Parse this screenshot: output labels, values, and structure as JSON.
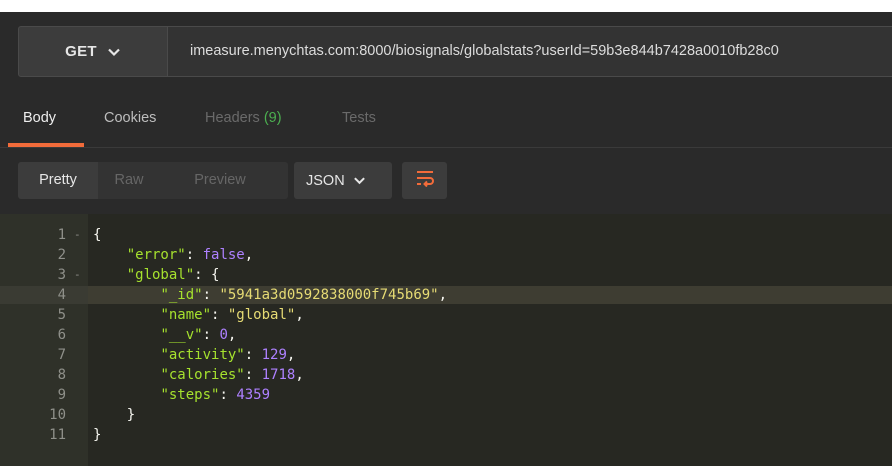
{
  "request": {
    "method": "GET",
    "url": "imeasure.menychtas.com:8000/biosignals/globalstats?userId=59b3e844b7428a0010fb28c0"
  },
  "response_tabs": [
    {
      "label": "Body"
    },
    {
      "label": "Cookies"
    },
    {
      "label": "Headers",
      "count": "(9)"
    },
    {
      "label": "Tests"
    }
  ],
  "view_modes": {
    "pretty": "Pretty",
    "raw": "Raw",
    "preview": "Preview",
    "format": "JSON"
  },
  "colors": {
    "accent": "#f26b3a",
    "count_green": "#4caf50",
    "json_key": "#a6e22e",
    "json_string": "#e6db74",
    "json_number": "#ae81ff"
  },
  "code_lines": [
    {
      "ln": "1",
      "fold": "-",
      "tokens": [
        [
          "p",
          "{"
        ]
      ]
    },
    {
      "ln": "2",
      "tokens": [
        [
          "p",
          "    "
        ],
        [
          "k",
          "\"error\""
        ],
        [
          "p",
          ": "
        ],
        [
          "n",
          "false"
        ],
        [
          "p",
          ","
        ]
      ]
    },
    {
      "ln": "3",
      "fold": "-",
      "tokens": [
        [
          "p",
          "    "
        ],
        [
          "k",
          "\"global\""
        ],
        [
          "p",
          ": {"
        ]
      ]
    },
    {
      "ln": "4",
      "hl": true,
      "tokens": [
        [
          "p",
          "        "
        ],
        [
          "k",
          "\"_id\""
        ],
        [
          "p",
          ": "
        ],
        [
          "s",
          "\"5941a3d0592838000f745b69\""
        ],
        [
          "p",
          ","
        ]
      ]
    },
    {
      "ln": "5",
      "tokens": [
        [
          "p",
          "        "
        ],
        [
          "k",
          "\"name\""
        ],
        [
          "p",
          ": "
        ],
        [
          "s",
          "\"global\""
        ],
        [
          "p",
          ","
        ]
      ]
    },
    {
      "ln": "6",
      "tokens": [
        [
          "p",
          "        "
        ],
        [
          "k",
          "\"__v\""
        ],
        [
          "p",
          ": "
        ],
        [
          "n",
          "0"
        ],
        [
          "p",
          ","
        ]
      ]
    },
    {
      "ln": "7",
      "tokens": [
        [
          "p",
          "        "
        ],
        [
          "k",
          "\"activity\""
        ],
        [
          "p",
          ": "
        ],
        [
          "n",
          "129"
        ],
        [
          "p",
          ","
        ]
      ]
    },
    {
      "ln": "8",
      "tokens": [
        [
          "p",
          "        "
        ],
        [
          "k",
          "\"calories\""
        ],
        [
          "p",
          ": "
        ],
        [
          "n",
          "1718"
        ],
        [
          "p",
          ","
        ]
      ]
    },
    {
      "ln": "9",
      "tokens": [
        [
          "p",
          "        "
        ],
        [
          "k",
          "\"steps\""
        ],
        [
          "p",
          ": "
        ],
        [
          "n",
          "4359"
        ]
      ]
    },
    {
      "ln": "10",
      "tokens": [
        [
          "p",
          "    }"
        ]
      ]
    },
    {
      "ln": "11",
      "tokens": [
        [
          "p",
          "}"
        ]
      ]
    }
  ]
}
